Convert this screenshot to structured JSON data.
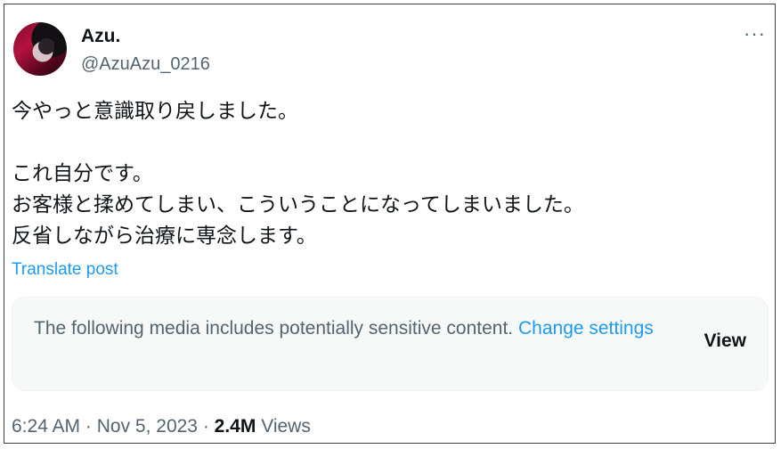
{
  "author": {
    "name": "Azu.",
    "handle": "@AzuAzu_0216"
  },
  "more_icon": "···",
  "tweet": {
    "lines": [
      "今やっと意識取り戻しました。",
      "",
      "これ自分です。",
      "お客様と揉めてしまい、こういうことになってしまいました。",
      "反省しながら治療に専念します。"
    ]
  },
  "translate_label": "Translate post",
  "sensitive": {
    "message": "The following media includes potentially sensitive content.",
    "link_text": "Change settings",
    "view_label": "View"
  },
  "meta": {
    "time": "6:24 AM",
    "sep1": " · ",
    "date": "Nov 5, 2023",
    "sep2": " · ",
    "views_count": "2.4M",
    "views_label": "Views"
  },
  "colors": {
    "link": "#1d9bf0",
    "secondary_text": "#536471",
    "primary_text": "#0f1419"
  }
}
